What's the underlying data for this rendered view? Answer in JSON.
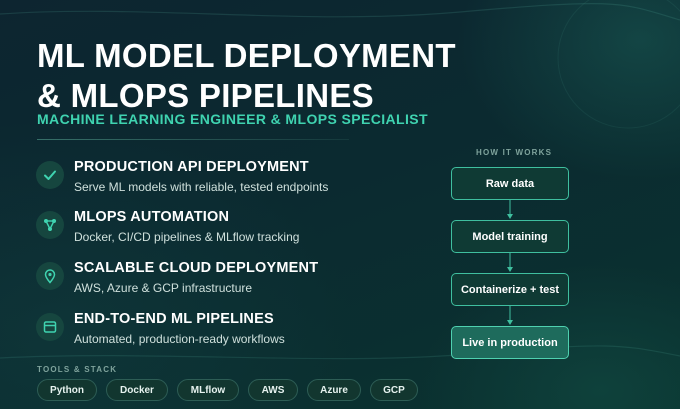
{
  "header": {
    "title_line1": "ML MODEL DEPLOYMENT",
    "title_line2": "& MLOPS PIPELINES",
    "subtitle": "MACHINE LEARNING ENGINEER & MLOPS SPECIALIST"
  },
  "features": [
    {
      "icon": "check-icon",
      "title": "PRODUCTION API DEPLOYMENT",
      "description": "Serve ML models with reliable, tested endpoints"
    },
    {
      "icon": "network-icon",
      "title": "MLOPS AUTOMATION",
      "description": "Docker, CI/CD pipelines & MLflow tracking"
    },
    {
      "icon": "location-pin-icon",
      "title": "SCALABLE CLOUD DEPLOYMENT",
      "description": "AWS, Azure & GCP infrastructure"
    },
    {
      "icon": "window-icon",
      "title": "END-TO-END ML PIPELINES",
      "description": "Automated, production-ready workflows"
    }
  ],
  "tools": {
    "label": "TOOLS & STACK",
    "items": [
      "Python",
      "Docker",
      "MLflow",
      "AWS",
      "Azure",
      "GCP"
    ]
  },
  "how_it_works": {
    "label": "HOW IT WORKS",
    "steps": [
      "Raw data",
      "Model training",
      "Containerize + test",
      "Live in production"
    ]
  },
  "colors": {
    "accent": "#3fd3b0",
    "background": "#0b2a30",
    "icon_bg": "#16463f"
  }
}
